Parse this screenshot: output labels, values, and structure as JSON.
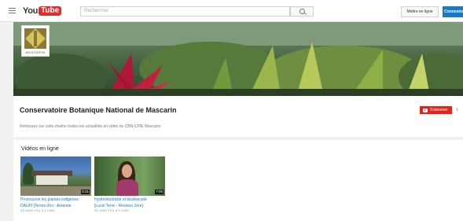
{
  "header": {
    "logo_you": "You",
    "logo_tube": "Tube",
    "search_placeholder": "Rechercher",
    "upload_label": "Mettre en ligne",
    "signin_label": "Connexion"
  },
  "channel": {
    "avatar_caption": "MASCARIN",
    "title": "Conservatoire Botanique National de Mascarin",
    "subscribe_label": "S'abonner",
    "subscriber_count": "1",
    "description": "Retrouvez sur cette chaîne toutes les actualités en vidéo du CBN-CPIE Mascarin"
  },
  "videos_section": {
    "title": "Vidéos en ligne",
    "videos": [
      {
        "title_line1": "Promouvoir les plantes indigènes -",
        "title_line2": "DAUPI [Terres d'ici - Antenne",
        "meta": "22 vues • il y a 1 mois",
        "duration": "5:31"
      },
      {
        "title_line1": "Hydroélectricité et biodiversité",
        "title_line2": "[Lucie Terre - Réunion 1ère]",
        "meta": "21 vues • il y a 1 mois",
        "duration": "7:05"
      }
    ]
  },
  "colors": {
    "accent_red": "#e62117",
    "signin_blue": "#167ac6",
    "youtube_red": "#e52d27"
  }
}
